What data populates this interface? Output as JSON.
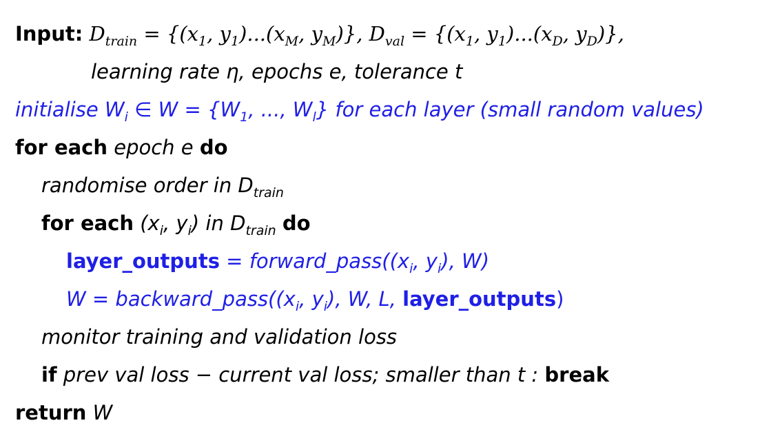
{
  "lines": {
    "input_keyword": "Input:",
    "input_math": "D",
    "input_train_sub": "train",
    "input_eq1": " = {(x",
    "input_1a": "1",
    "input_y1": ", y",
    "input_1b": "1",
    "input_dots1": ")...(x",
    "input_Msub1": "M",
    "input_yM": ", y",
    "input_Msub2": "M",
    "input_close1": ")}, D",
    "input_val_sub": "val",
    "input_eq2": " = {(x",
    "input_1c": "1",
    "input_y1b": ", y",
    "input_1d": "1",
    "input_dots2": ")...(x",
    "input_Dsub1": "D",
    "input_yD": ", y",
    "input_Dsub2": "D",
    "input_close2": ")},",
    "params": "learning rate η,  epochs e,  tolerance t",
    "init_text": "initialise W",
    "init_i": "i",
    "init_rest": " ∈ W = {W",
    "init_1": "1",
    "init_dots": ", ..., W",
    "init_l": "l",
    "init_tail": "}  for each layer (small random values)",
    "for_each": "for each",
    "epoch_text": "epoch e",
    "do": "do",
    "randomise": "randomise order in D",
    "randomise_sub": "train",
    "for_each2": "for each",
    "pair_open": "(x",
    "pair_i1": "i",
    "pair_y": ", y",
    "pair_i2": "i",
    "pair_close": ")",
    "in_text": " in D",
    "in_sub": "train",
    "do2": "do",
    "layer_outputs": "layer_outputs",
    "assign1": " =  ",
    "forward_pass": "forward_pass((x",
    "fp_i1": "i",
    "fp_y": ", y",
    "fp_i2": "i",
    "fp_close": "), W)",
    "w_assign": "W =  ",
    "backward_pass": "backward_pass((x",
    "bp_i1": "i",
    "bp_y": ", y",
    "bp_i2": "i",
    "bp_mid": "), W, L, ",
    "bp_layer_outputs": "layer_outputs",
    "bp_close": ")",
    "monitor": "monitor training and validation loss",
    "if_kw": "if",
    "if_cond": "prev val loss  −  current val loss;  smaller than t :",
    "break_kw": "break",
    "return_kw": "return",
    "return_val": "W"
  }
}
